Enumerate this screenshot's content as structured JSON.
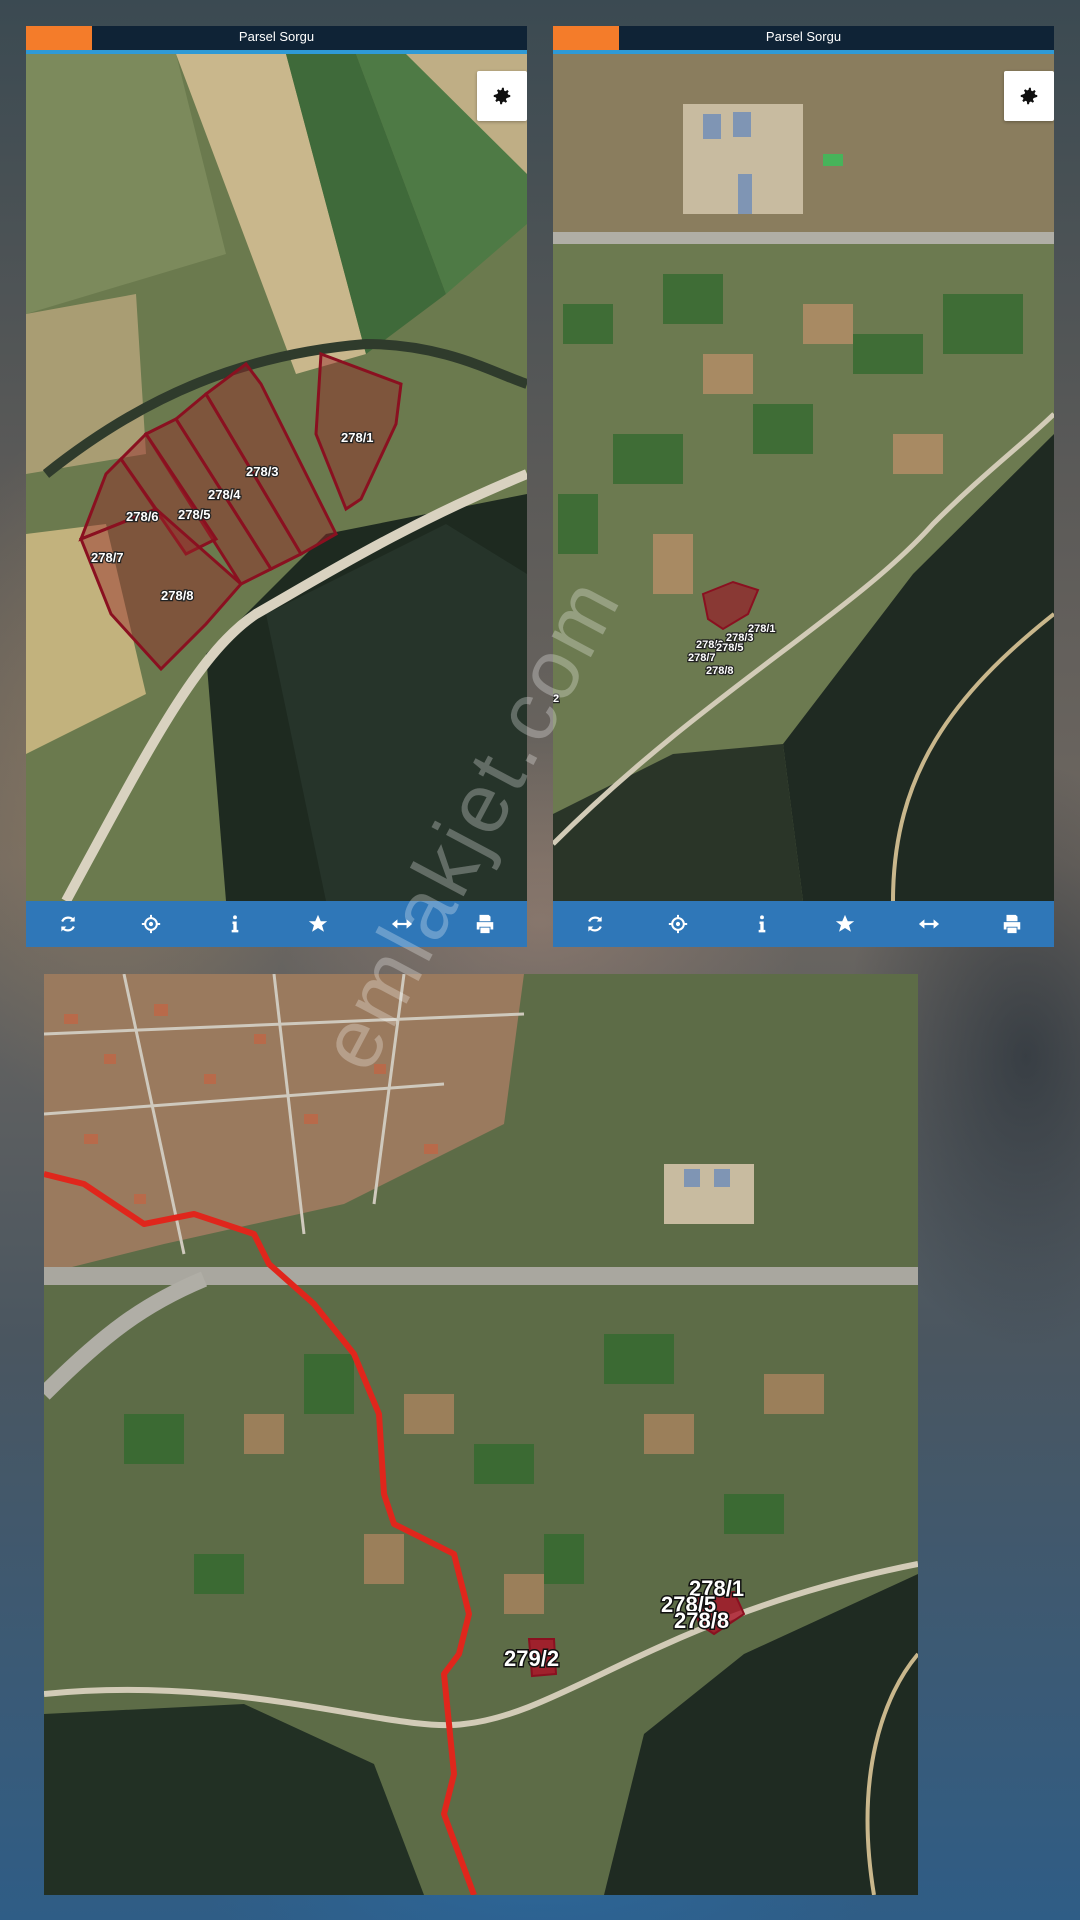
{
  "panels": [
    {
      "title": "Parsel Sorgu",
      "parcels": [
        "278/1",
        "278/3",
        "278/4",
        "278/5",
        "278/6",
        "278/7",
        "278/8"
      ]
    },
    {
      "title": "Parsel Sorgu",
      "parcels": [
        "278/1",
        "278/3",
        "278/6",
        "278/5",
        "278/7",
        "278/8"
      ],
      "edge_label": "2"
    }
  ],
  "toolbar_icons": [
    "refresh-icon",
    "locate-icon",
    "info-icon",
    "star-icon",
    "measure-icon",
    "print-icon"
  ],
  "overview": {
    "parcels": [
      "278/1",
      "278/5",
      "278/8",
      "279/2"
    ]
  },
  "watermark": "emlakjet.com",
  "colors": {
    "accent": "#f47c2a",
    "titlebar": "#0f2336",
    "toolbar": "#2f77b8",
    "parcel_outline": "#8a1020",
    "route": "#e0261c"
  }
}
